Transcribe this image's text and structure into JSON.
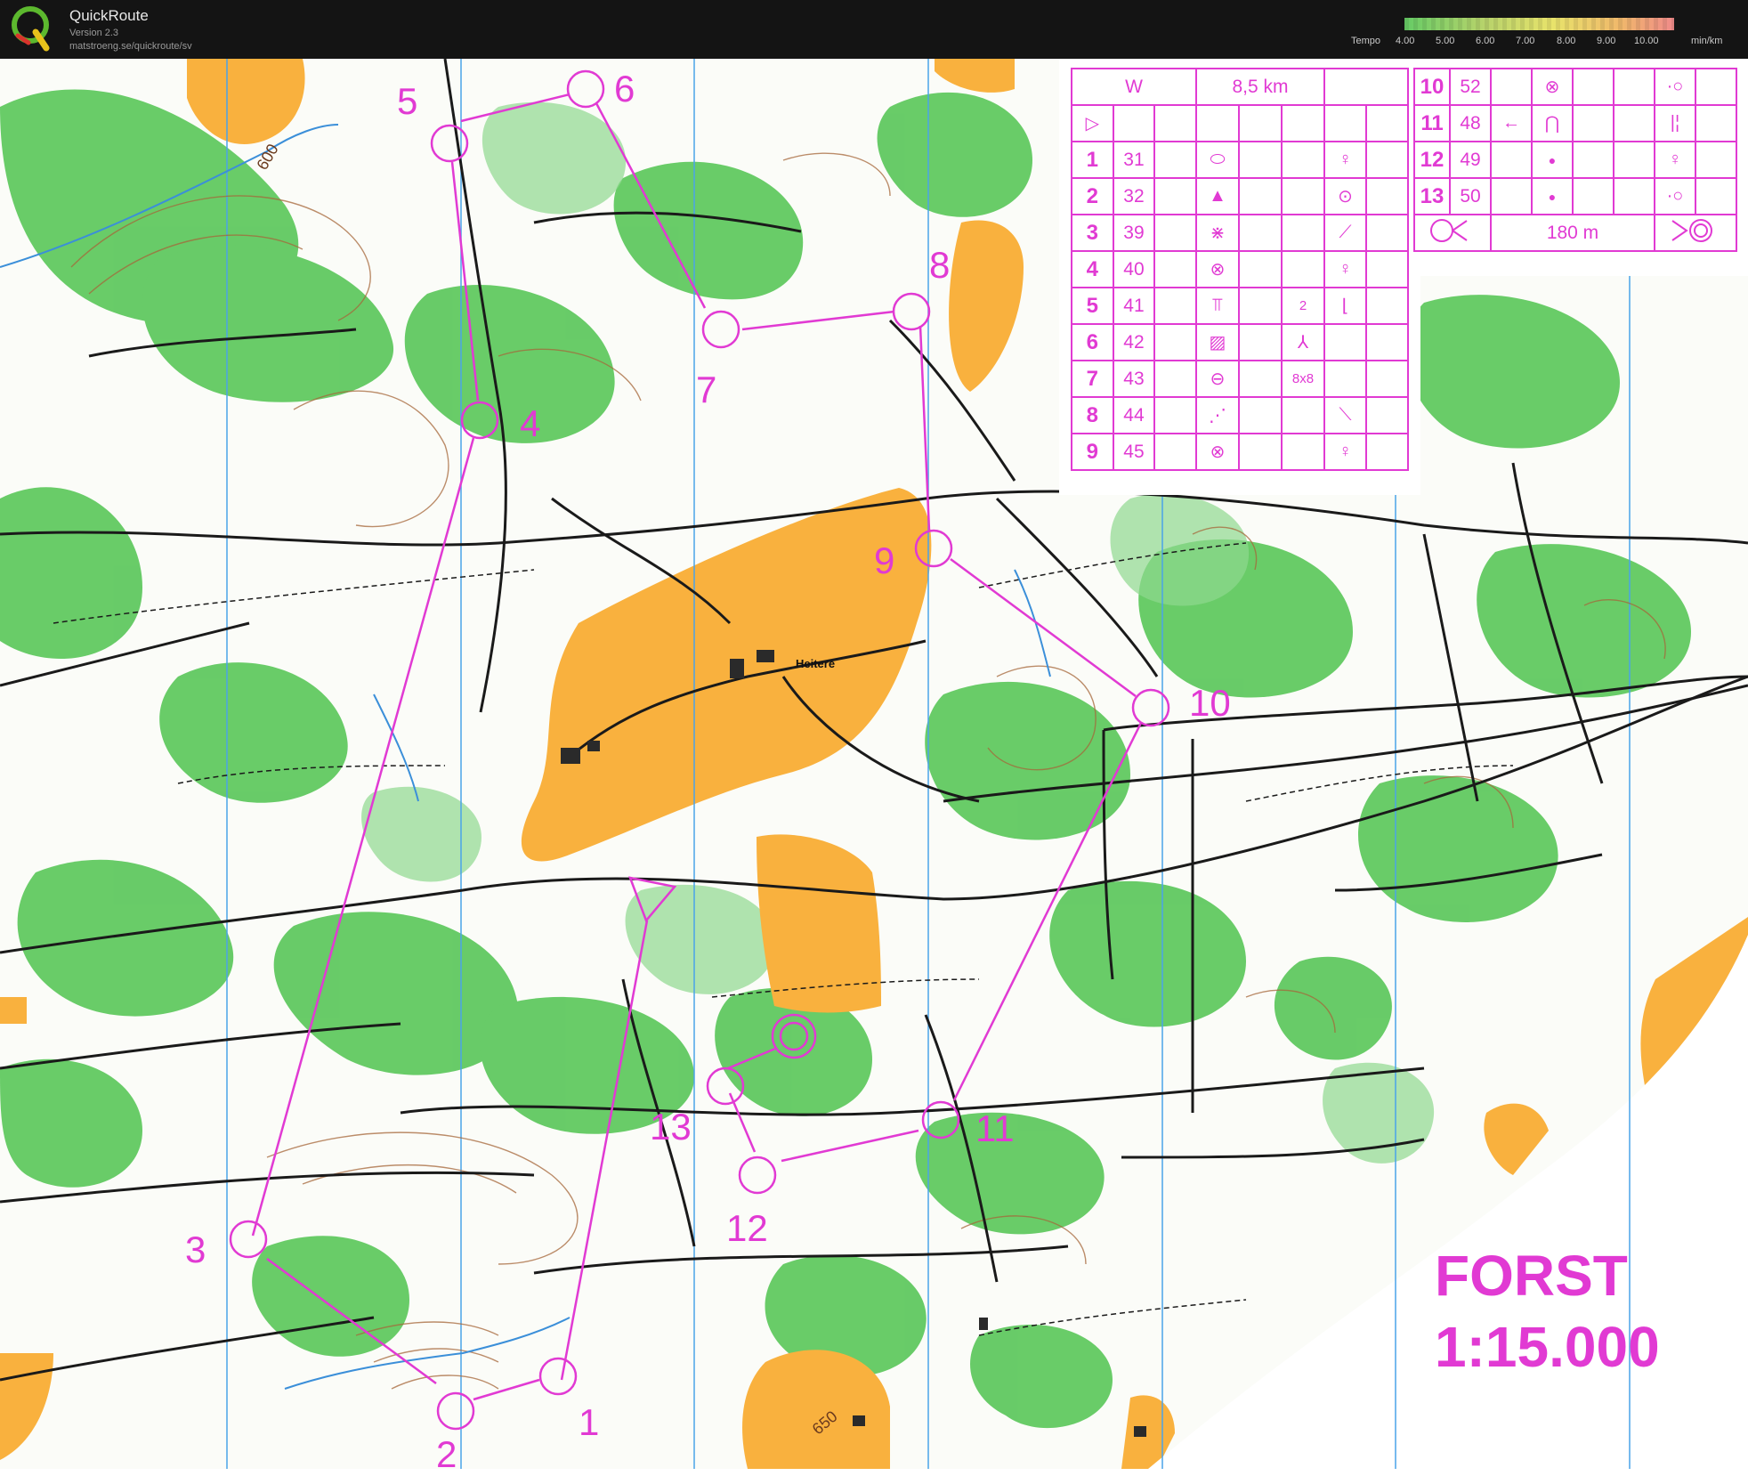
{
  "app": {
    "title": "QuickRoute",
    "version": "Version 2.3",
    "url": "matstroeng.se/quickroute/sv",
    "logo_letter": "Q"
  },
  "tempo": {
    "label": "Tempo",
    "ticks": [
      "4.00",
      "5.00",
      "6.00",
      "7.00",
      "8.00",
      "9.00",
      "10.00"
    ],
    "unit": "min/km",
    "gradient_colors": [
      "#66cc66",
      "#b8d36b",
      "#e8e36b",
      "#f0b86b",
      "#f08a8a"
    ]
  },
  "map": {
    "place_label": "Heitere",
    "contour_labels": [
      "600",
      "650"
    ],
    "course_color": "#e13ad3",
    "control_numbers": [
      "1",
      "2",
      "3",
      "4",
      "5",
      "6",
      "7",
      "8",
      "9",
      "10",
      "11",
      "12",
      "13"
    ],
    "forst_label": "FORST",
    "scale_label": "1:15.000"
  },
  "control_descriptions": {
    "class": "W",
    "length": "8,5 km",
    "start_symbol": "▷",
    "rows_left": [
      {
        "n": "1",
        "code": "31",
        "feature": "⬭",
        "detail": "",
        "extra": "♀"
      },
      {
        "n": "2",
        "code": "32",
        "feature": "▲",
        "detail": "",
        "extra": "⊙"
      },
      {
        "n": "3",
        "code": "39",
        "feature": "⋇",
        "detail": "",
        "extra": "⟋"
      },
      {
        "n": "4",
        "code": "40",
        "feature": "⊗",
        "detail": "",
        "extra": "♀"
      },
      {
        "n": "5",
        "code": "41",
        "feature": "⫪",
        "detail": "2",
        "extra": "⌊"
      },
      {
        "n": "6",
        "code": "42",
        "feature": "▨",
        "detail": "⅄",
        "extra": ""
      },
      {
        "n": "7",
        "code": "43",
        "feature": "⊖",
        "detail": "8x8",
        "extra": ""
      },
      {
        "n": "8",
        "code": "44",
        "feature": "⋰",
        "detail": "",
        "extra": "⟍"
      },
      {
        "n": "9",
        "code": "45",
        "feature": "⊗",
        "detail": "",
        "extra": "♀"
      }
    ],
    "rows_right": [
      {
        "n": "10",
        "code": "52",
        "dir": "",
        "feature": "⊗",
        "extra": "·○"
      },
      {
        "n": "11",
        "code": "48",
        "dir": "←",
        "feature": "⋂",
        "extra": "|¦"
      },
      {
        "n": "12",
        "code": "49",
        "dir": "",
        "feature": "●",
        "extra": "♀"
      },
      {
        "n": "13",
        "code": "50",
        "dir": "",
        "feature": "●",
        "extra": "·○"
      }
    ],
    "finish_distance": "180 m"
  }
}
